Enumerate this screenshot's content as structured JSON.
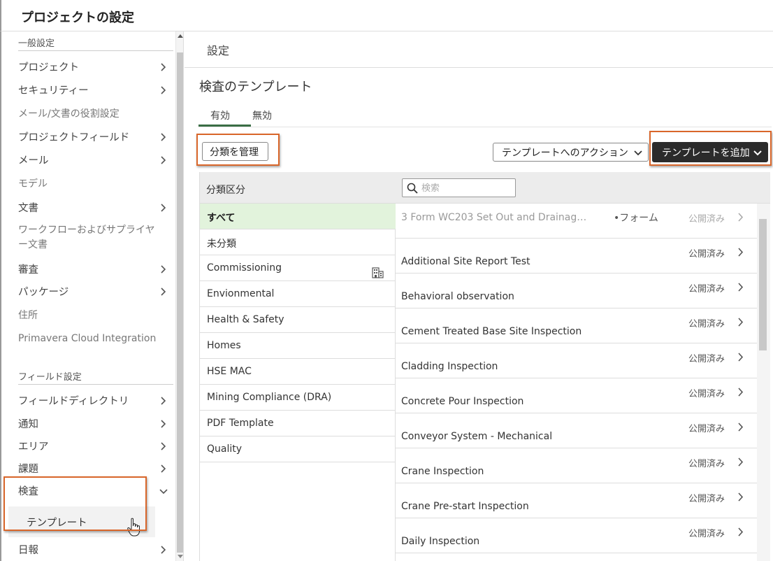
{
  "header": {
    "title": "プロジェクトの設定"
  },
  "sidebar": {
    "general_section": "一般設定",
    "items": [
      {
        "label": "プロジェクト",
        "chevron": "right"
      },
      {
        "label": "セキュリティー",
        "chevron": "right"
      },
      {
        "label": "メール/文書の役割設定",
        "chevron": "none"
      },
      {
        "label": "プロジェクトフィールド",
        "chevron": "right"
      },
      {
        "label": "メール",
        "chevron": "right"
      },
      {
        "label": "モデル",
        "chevron": "none"
      },
      {
        "label": "文書",
        "chevron": "right"
      },
      {
        "label": "ワークフローおよびサプライヤー文書",
        "chevron": "none"
      },
      {
        "label": "審査",
        "chevron": "right"
      },
      {
        "label": "パッケージ",
        "chevron": "right"
      },
      {
        "label": "住所",
        "chevron": "none"
      },
      {
        "label": "Primavera Cloud Integration",
        "chevron": "none"
      }
    ],
    "field_section": "フィールド設定",
    "field_items": [
      {
        "label": "フィールドディレクトリ",
        "chevron": "right"
      },
      {
        "label": "通知",
        "chevron": "right"
      },
      {
        "label": "エリア",
        "chevron": "right"
      },
      {
        "label": "課題",
        "chevron": "right"
      },
      {
        "label": "検査",
        "chevron": "down"
      },
      {
        "label": "日報",
        "chevron": "right"
      }
    ],
    "sub_item": "テンプレート"
  },
  "main": {
    "breadcrumb": "設定",
    "page_title": "検査のテンプレート",
    "tabs": [
      {
        "label": "有効",
        "active": true
      },
      {
        "label": "無効",
        "active": false
      }
    ],
    "manage_categories_button": "分類を管理",
    "actions_dropdown": "テンプレートへのアクション",
    "add_template_button": "テンプレートを追加",
    "category_header": "分類区分",
    "categories": [
      {
        "label": "すべて",
        "selected": true
      },
      {
        "label": "未分類"
      },
      {
        "label": "Commissioning",
        "icon": "building-icon"
      },
      {
        "label": "Envionmental"
      },
      {
        "label": "Health & Safety"
      },
      {
        "label": "Homes"
      },
      {
        "label": "HSE MAC"
      },
      {
        "label": "Mining Compliance (DRA)"
      },
      {
        "label": "PDF Template"
      },
      {
        "label": "Quality"
      }
    ],
    "search_placeholder": "検索",
    "templates": [
      {
        "name": "3 Form WC203 Set Out and Drainag…",
        "form": "•フォーム",
        "status": "公開済み"
      },
      {
        "name": "Additional Site Report Test",
        "status": "公開済み"
      },
      {
        "name": "Behavioral observation",
        "status": "公開済み"
      },
      {
        "name": "Cement Treated Base Site Inspection",
        "status": "公開済み"
      },
      {
        "name": "Cladding Inspection",
        "status": "公開済み"
      },
      {
        "name": "Concrete Pour Inspection",
        "status": "公開済み"
      },
      {
        "name": "Conveyor System - Mechanical",
        "status": "公開済み"
      },
      {
        "name": "Crane Inspection",
        "status": "公開済み"
      },
      {
        "name": "Crane Pre-start Inspection",
        "status": "公開済み"
      },
      {
        "name": "Daily Inspection",
        "status": "公開済み"
      }
    ]
  },
  "colors": {
    "highlight": "#d9662a",
    "active_tab": "#3a6e45",
    "selected_category": "#e2f3dc",
    "primary_button": "#2b2b2b"
  }
}
